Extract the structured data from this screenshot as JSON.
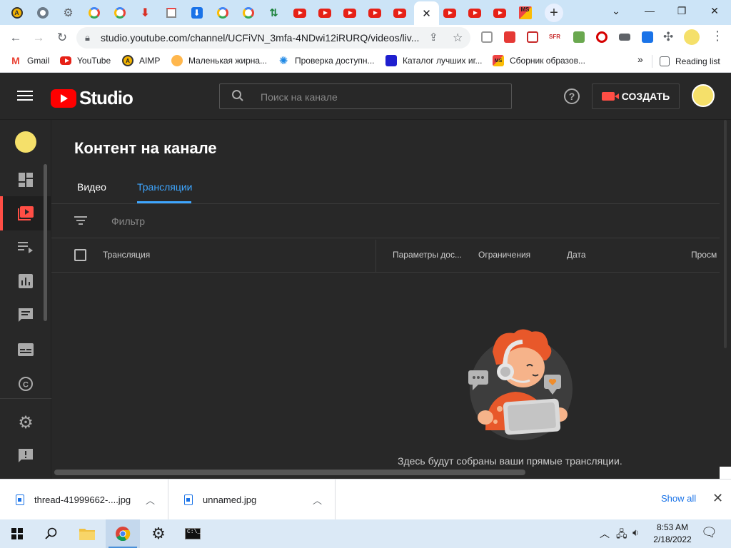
{
  "browser": {
    "tabs": [
      {
        "icon": "aimp-icon",
        "kind": "aimp"
      },
      {
        "icon": "chrome-icon",
        "kind": "chrome"
      },
      {
        "icon": "gear-icon",
        "kind": "gear"
      },
      {
        "icon": "google-icon",
        "kind": "google"
      },
      {
        "icon": "google-icon",
        "kind": "google"
      },
      {
        "icon": "download-red-icon",
        "kind": "dlred"
      },
      {
        "icon": "page-icon",
        "kind": "page"
      },
      {
        "icon": "download-blue-icon",
        "kind": "dlblue"
      },
      {
        "icon": "google-icon",
        "kind": "google"
      },
      {
        "icon": "google-icon",
        "kind": "google"
      },
      {
        "icon": "sort-icon",
        "kind": "sort"
      },
      {
        "icon": "youtube-icon",
        "kind": "yt"
      },
      {
        "icon": "youtube-icon",
        "kind": "yt"
      },
      {
        "icon": "youtube-icon",
        "kind": "yt"
      },
      {
        "icon": "youtube-icon",
        "kind": "yt"
      },
      {
        "icon": "youtube-icon",
        "kind": "yt"
      },
      {
        "icon": "close-icon",
        "kind": "active"
      },
      {
        "icon": "youtube-icon",
        "kind": "yt"
      },
      {
        "icon": "youtube-icon",
        "kind": "yt"
      },
      {
        "icon": "youtube-icon",
        "kind": "yt"
      },
      {
        "icon": "ms-icon",
        "kind": "ms"
      }
    ],
    "url": "studio.youtube.com/channel/UCFiVN_3mfa-4NDwi12iRURQ/videos/liv...",
    "bookmarks": [
      {
        "label": "Gmail",
        "icon": "gmail-icon"
      },
      {
        "label": "YouTube",
        "icon": "youtube-icon"
      },
      {
        "label": "AIMP",
        "icon": "aimp-icon"
      },
      {
        "label": "Маленькая жирна...",
        "icon": "flame-icon"
      },
      {
        "label": "Проверка доступн...",
        "icon": "gear-blue-icon"
      },
      {
        "label": "Каталог лучших иг...",
        "icon": "catalog-icon"
      },
      {
        "label": "Сборник образов...",
        "icon": "ms-icon"
      }
    ],
    "reading_list": "Reading list",
    "more_bookmarks": "»"
  },
  "studio": {
    "logo_text": "Studio",
    "search_placeholder": "Поиск на канале",
    "create_label": "СОЗДАТЬ",
    "help_glyph": "?",
    "page_title": "Контент на канале",
    "tabs": [
      {
        "label": "Видео",
        "selected": false
      },
      {
        "label": "Трансляции",
        "selected": true
      }
    ],
    "filter_placeholder": "Фильтр",
    "columns": [
      "Трансляция",
      "Параметры дос...",
      "Ограничения",
      "Дата",
      "Просм"
    ],
    "empty_message": "Здесь будут собраны ваши прямые трансляции.",
    "sidebar": [
      {
        "name": "dashboard",
        "active": false
      },
      {
        "name": "content",
        "active": true
      },
      {
        "name": "playlists",
        "active": false
      },
      {
        "name": "analytics",
        "active": false
      },
      {
        "name": "comments",
        "active": false
      },
      {
        "name": "subtitles",
        "active": false
      },
      {
        "name": "copyright",
        "active": false
      },
      {
        "name": "settings",
        "active": false
      },
      {
        "name": "feedback",
        "active": false
      }
    ]
  },
  "downloads": {
    "items": [
      {
        "filename": "thread-41999662-....jpg"
      },
      {
        "filename": "unnamed.jpg"
      }
    ],
    "show_all": "Show all"
  },
  "taskbar": {
    "time": "8:53 AM",
    "date": "2/18/2022"
  },
  "colors": {
    "accent_blue": "#3ea6ff",
    "youtube_red": "#ff0000",
    "active_red": "#ff4e45",
    "background": "#282828"
  }
}
